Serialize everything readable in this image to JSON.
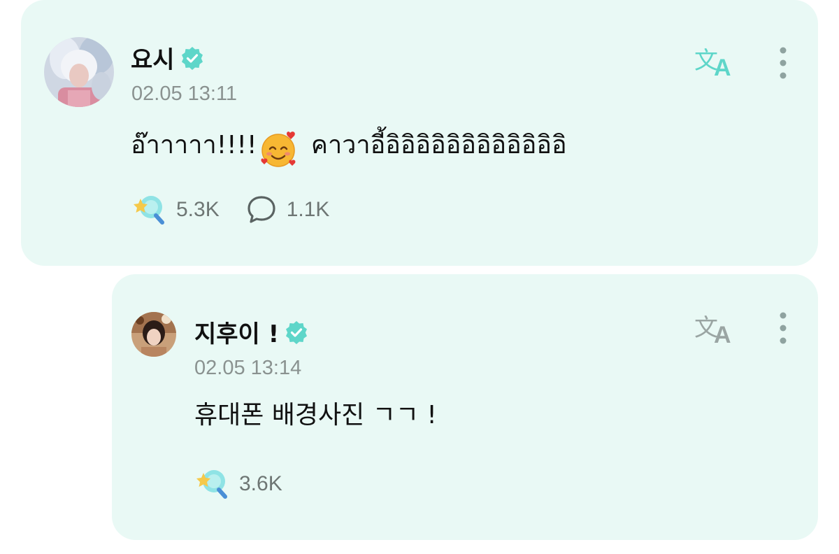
{
  "post": {
    "author": "요시",
    "timestamp": "02.05 13:11",
    "text_before_emoji": "อ๊าาาาา!!!!",
    "text_after_emoji": " คาวาอี้อิอิอิอิอิอิอิอิอิอิอิอิ",
    "emoji": "smiling-face-with-hearts",
    "likes": "5.3K",
    "comments": "1.1K"
  },
  "reply": {
    "author": "지후이 !",
    "timestamp": "02.05 13:14",
    "text": "휴대폰 배경사진 ㄱㄱ !",
    "likes": "3.6K"
  },
  "colors": {
    "card_background": "#e9f9f5",
    "accent": "#5ed6c9",
    "verified_badge": "#5ed6c9"
  }
}
